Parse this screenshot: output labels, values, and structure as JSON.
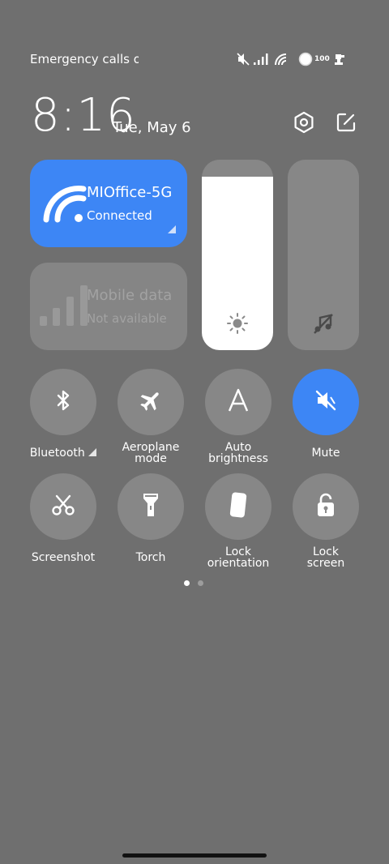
{
  "status_bar": {
    "carrier_text": "Emergency calls o",
    "battery_level": "100"
  },
  "header": {
    "time": "8:16",
    "date": "Tue, May 6"
  },
  "tiles": {
    "wifi": {
      "title": "MIOffice-5G",
      "subtitle": "Connected",
      "active": true
    },
    "mobile_data": {
      "title": "Mobile data",
      "subtitle": "Not available",
      "active": false
    }
  },
  "sliders": {
    "brightness_level": 0.91,
    "volume_level": 0.0
  },
  "toggles": [
    {
      "id": "bluetooth",
      "label_line1": "Bluetooth",
      "label_line2": "",
      "icon": "bluetooth-icon",
      "active": false
    },
    {
      "id": "aeroplane",
      "label_line1": "Aeroplane",
      "label_line2": "mode",
      "icon": "airplane-icon",
      "active": false
    },
    {
      "id": "auto-brightness",
      "label_line1": "Auto",
      "label_line2": "brightness",
      "icon": "auto-brightness-icon",
      "active": false
    },
    {
      "id": "mute",
      "label_line1": "Mute",
      "label_line2": "",
      "icon": "mute-icon",
      "active": true
    },
    {
      "id": "screenshot",
      "label_line1": "Screenshot",
      "label_line2": "",
      "icon": "scissors-icon",
      "active": false
    },
    {
      "id": "torch",
      "label_line1": "Torch",
      "label_line2": "",
      "icon": "flashlight-icon",
      "active": false
    },
    {
      "id": "lock-orientation",
      "label_line1": "Lock",
      "label_line2": "orientation",
      "icon": "phone-rotation-icon",
      "active": false
    },
    {
      "id": "lock-screen",
      "label_line1": "Lock",
      "label_line2": "screen",
      "icon": "padlock-icon",
      "active": false
    }
  ],
  "pager": {
    "pages": 2,
    "current": 1
  },
  "colors": {
    "background": "#6f6f6f",
    "accent": "#3d86f5",
    "tile_inactive": "#878787"
  }
}
